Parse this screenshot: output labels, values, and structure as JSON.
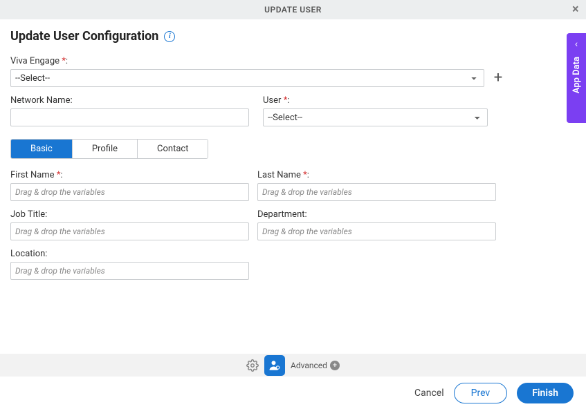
{
  "header": {
    "title": "UPDATE USER"
  },
  "page": {
    "title": "Update User Configuration"
  },
  "form": {
    "viva_label": "Viva Engage",
    "viva_select": "--Select--",
    "network_label": "Network Name:",
    "user_label": "User",
    "user_select": "--Select--",
    "placeholder": "Drag & drop the variables",
    "first_name_label": "First Name",
    "last_name_label": "Last Name",
    "job_title_label": "Job Title:",
    "department_label": "Department:",
    "location_label": "Location:"
  },
  "tabs": {
    "basic": "Basic",
    "profile": "Profile",
    "contact": "Contact"
  },
  "footer": {
    "advanced": "Advanced"
  },
  "actions": {
    "cancel": "Cancel",
    "prev": "Prev",
    "finish": "Finish"
  },
  "side": {
    "label": "App Data"
  }
}
